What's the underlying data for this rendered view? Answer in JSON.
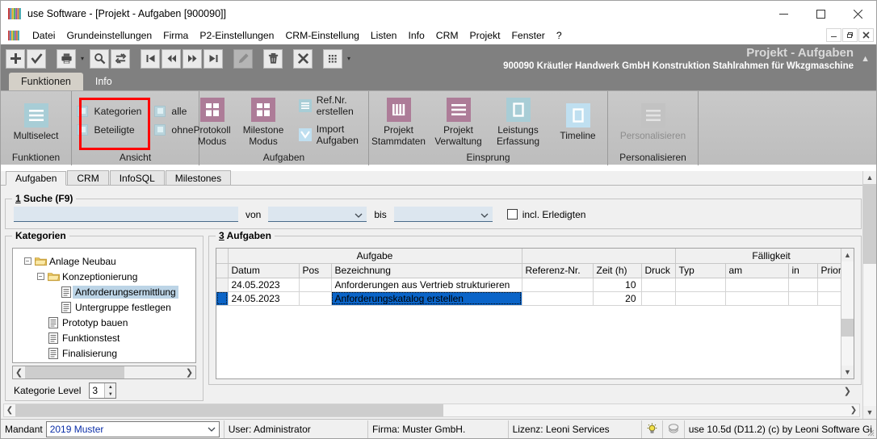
{
  "window": {
    "title": "use Software - [Projekt - Aufgaben [900090]]",
    "app_icon": "use-logo-icon",
    "minimize": "minimize-icon",
    "maximize": "maximize-icon",
    "close": "close-icon",
    "mdi_minimize": "mdi-minimize-icon",
    "mdi_restore": "mdi-restore-icon",
    "mdi_close": "mdi-close-icon"
  },
  "menubar": {
    "items": [
      {
        "label": "Datei",
        "accel": "D"
      },
      {
        "label": "Grundeinstellungen",
        "accel": "G"
      },
      {
        "label": "Firma",
        "accel": "m"
      },
      {
        "label": "P2-Einstellungen",
        "accel": "2"
      },
      {
        "label": "CRM-Einstellung",
        "accel": "R"
      },
      {
        "label": "Listen",
        "accel": "L"
      },
      {
        "label": "Info",
        "accel": "n"
      },
      {
        "label": "CRM",
        "accel": "C"
      },
      {
        "label": "Projekt",
        "accel": "P"
      },
      {
        "label": "Fenster",
        "accel": "F"
      },
      {
        "label": "?",
        "accel": "?"
      }
    ]
  },
  "toolbar": {
    "buttons": [
      {
        "name": "new-record-button",
        "icon": "plus-icon"
      },
      {
        "name": "confirm-button",
        "icon": "check-icon"
      },
      {
        "name": "print-button",
        "icon": "printer-icon"
      },
      {
        "name": "print-dropdown-button",
        "icon": "caret-down-icon"
      },
      {
        "name": "search-button",
        "icon": "magnifier-icon"
      },
      {
        "name": "refresh-button",
        "icon": "refresh-icon"
      },
      {
        "name": "first-record-button",
        "icon": "first-icon"
      },
      {
        "name": "previous-record-button",
        "icon": "previous-icon"
      },
      {
        "name": "next-record-button",
        "icon": "next-icon"
      },
      {
        "name": "last-record-button",
        "icon": "last-icon"
      },
      {
        "name": "edit-button",
        "icon": "pencil-icon"
      },
      {
        "name": "delete-button",
        "icon": "trash-icon"
      },
      {
        "name": "cancel-button",
        "icon": "x-icon"
      },
      {
        "name": "grid-button",
        "icon": "grid-icon"
      },
      {
        "name": "grid-dropdown-button",
        "icon": "caret-down-icon"
      }
    ]
  },
  "header": {
    "title": "Projekt - Aufgaben",
    "subtitle": "900090 Kräutler Handwerk GmbH  Konstruktion Stahlrahmen für Wkzgmaschine",
    "collapse_icon": "chevron-up-icon"
  },
  "ribbon": {
    "tabs": [
      {
        "label": "Funktionen",
        "active": true
      },
      {
        "label": "Info",
        "active": false
      }
    ],
    "groups": [
      {
        "name": "funktionen",
        "label": "Funktionen",
        "buttons": [
          {
            "label": "Multiselect",
            "icon": "list-lines-icon",
            "disabled": false
          }
        ]
      },
      {
        "name": "ansicht",
        "label": "Ansicht",
        "checks_left": [
          {
            "label": "Kategorien",
            "checked": false
          },
          {
            "label": "Beteiligte",
            "checked": false
          }
        ],
        "checks_right": [
          {
            "label": "alle",
            "checked": false
          },
          {
            "label": "ohne",
            "checked": false
          }
        ]
      },
      {
        "name": "aufgaben",
        "label": "Aufgaben",
        "buttons": [
          {
            "label": "Protokoll\nModus",
            "line1": "Protokoll",
            "line2": "Modus",
            "icon": "window-grid-icon"
          },
          {
            "label": "Milestone\nModus",
            "line1": "Milestone",
            "line2": "Modus",
            "icon": "window-grid-icon"
          }
        ],
        "small_buttons": [
          {
            "label": "Ref.Nr. erstellen",
            "icon": "list-lines-small-icon"
          },
          {
            "label": "Import Aufgaben",
            "icon": "import-down-icon"
          }
        ]
      },
      {
        "name": "einsprung",
        "label": "Einsprung",
        "buttons": [
          {
            "line1": "Projekt",
            "line2": "Stammdaten",
            "icon": "columns-icon"
          },
          {
            "line1": "Projekt",
            "line2": "Verwaltung",
            "icon": "list-lines-icon"
          },
          {
            "line1": "Leistungs",
            "line2": "Erfassung",
            "icon": "square-outline-icon"
          },
          {
            "line1": "Timeline",
            "line2": "",
            "icon": "square-outline-icon"
          }
        ]
      },
      {
        "name": "personalisieren",
        "label": "Personalisieren",
        "buttons": [
          {
            "line1": "Personalisieren",
            "line2": "",
            "icon": "list-lines-icon",
            "disabled": true
          }
        ]
      }
    ]
  },
  "form_tabs": [
    {
      "label": "Aufgaben",
      "active": true
    },
    {
      "label": "CRM",
      "active": false
    },
    {
      "label": "InfoSQL",
      "active": false
    },
    {
      "label": "Milestones",
      "active": false
    }
  ],
  "search": {
    "group_title": "1 Suche (F9)",
    "group_title_accel": "1",
    "group_title_rest": " Suche (F9)",
    "text_value": "",
    "text_placeholder": "",
    "von_label": "von",
    "von_value": "",
    "bis_label": "bis",
    "bis_value": "",
    "incl_label": "incl. Erledigten",
    "incl_checked": false
  },
  "kategorien": {
    "group_title": "Kategorien",
    "tree": [
      {
        "label": "Anlage Neubau",
        "level": 0,
        "icon": "folder-icon",
        "expander": "minus",
        "selected": false
      },
      {
        "label": "Konzeptionierung",
        "level": 1,
        "icon": "folder-icon",
        "expander": "minus",
        "selected": false
      },
      {
        "label": "Anforderungsermittlung",
        "level": 2,
        "icon": "document-icon",
        "expander": "",
        "selected": true
      },
      {
        "label": "Untergruppe festlegen",
        "level": 2,
        "icon": "document-icon",
        "expander": "",
        "selected": false
      },
      {
        "label": "Prototyp bauen",
        "level": 1,
        "icon": "document-icon",
        "expander": "",
        "selected": false
      },
      {
        "label": "Funktionstest",
        "level": 1,
        "icon": "document-icon",
        "expander": "",
        "selected": false
      },
      {
        "label": "Finalisierung",
        "level": 1,
        "icon": "document-icon",
        "expander": "",
        "selected": false
      }
    ],
    "level_label": "Kategorie Level",
    "level_value": "3"
  },
  "aufgaben": {
    "group_title": "3 Aufgaben",
    "group_title_accel": "3",
    "group_title_rest": " Aufgaben",
    "group_headers": [
      {
        "label": "Aufgabe",
        "span": 3
      },
      {
        "label": "",
        "span": 3
      },
      {
        "label": "Fälligkeit",
        "span": 3
      }
    ],
    "columns": [
      "Datum",
      "Pos",
      "Bezeichnung",
      "Referenz-Nr.",
      "Zeit (h)",
      "Druck",
      "Typ",
      "am",
      "in",
      "Priorität"
    ],
    "rows": [
      {
        "marker": "",
        "datum": "24.05.2023",
        "pos": "",
        "bezeichnung": "Anforderungen aus Vertrieb strukturieren",
        "referenz": "",
        "zeit": "10",
        "druck": "",
        "typ": "",
        "am": "",
        "in": "",
        "prioritaet": "",
        "selected": false
      },
      {
        "marker": "▶",
        "datum": "24.05.2023",
        "pos": "",
        "bezeichnung": "Anforderungskatalog erstellen",
        "referenz": "",
        "zeit": "20",
        "druck": "",
        "typ": "",
        "am": "",
        "in": "",
        "prioritaet": "",
        "selected": true
      }
    ]
  },
  "statusbar": {
    "mandant_label": "Mandant",
    "mandant_value": "2019 Muster",
    "user": "User: Administrator",
    "firma": "Firma: Muster GmbH.",
    "lizenz": "Lizenz: Leoni Services",
    "bulb_icon": "lightbulb-icon",
    "stack_icon": "layers-icon",
    "version": "use 10.5d (D11.2) (c) by Leoni Software Gi"
  },
  "colors": {
    "ribbon_bg": "#c2c2c2",
    "toolstrip_bg": "#808080",
    "accent_mauve": "#ad7c98",
    "accent_teal": "#a8cdd6",
    "accent_lightblue": "#bfdff0",
    "selection_blue": "#0a64c8",
    "tree_selection": "#bcd4e6",
    "field_blue": "#dce6ef",
    "highlight_red": "#ff0000"
  }
}
